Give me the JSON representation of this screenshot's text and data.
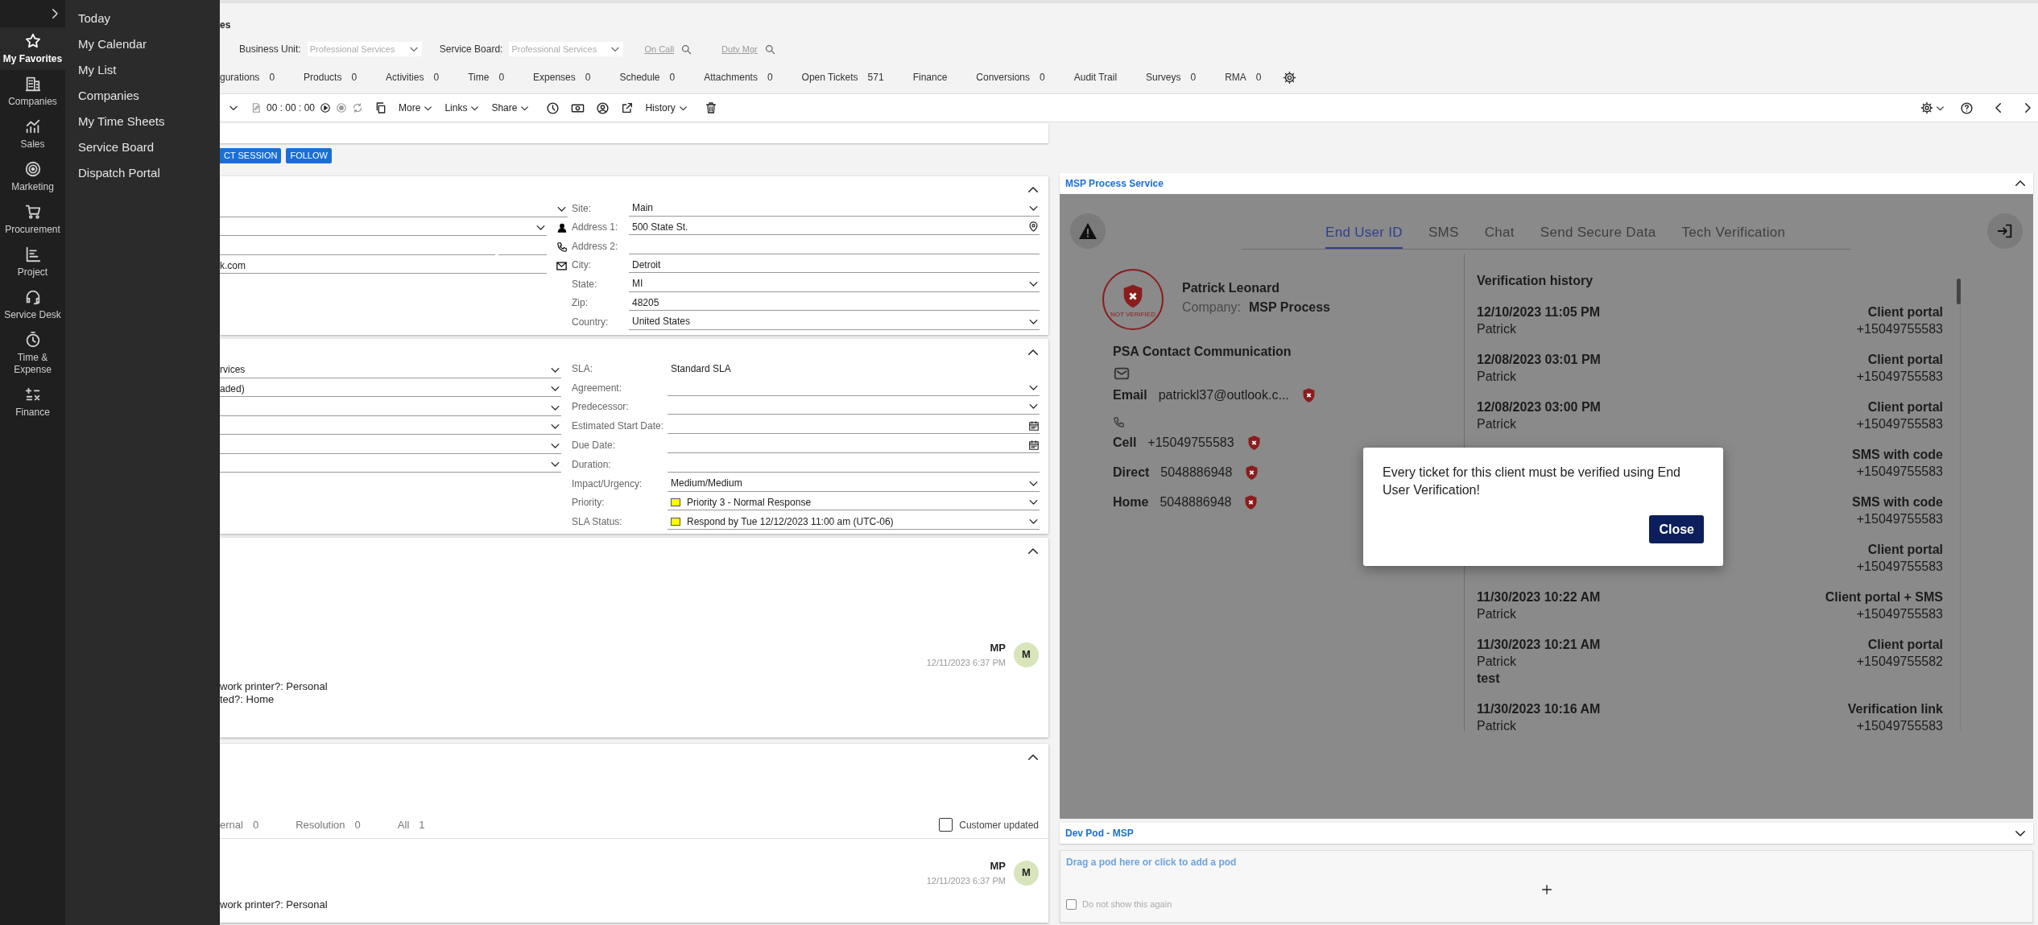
{
  "nav_rail": {
    "items": [
      {
        "label": "My Favorites",
        "selected": true
      },
      {
        "label": "Companies",
        "selected": false
      },
      {
        "label": "Sales",
        "selected": false
      },
      {
        "label": "Marketing",
        "selected": false
      },
      {
        "label": "Procurement",
        "selected": false
      },
      {
        "label": "Project",
        "selected": false
      },
      {
        "label": "Service Desk",
        "selected": false
      },
      {
        "label": "Time & Expense",
        "selected": false
      },
      {
        "label": "Finance",
        "selected": false
      }
    ]
  },
  "flyout": {
    "items": [
      "Today",
      "My Calendar",
      "My List",
      "Companies",
      "My Time Sheets",
      "Service Board",
      "Dispatch Portal"
    ]
  },
  "header": {
    "title": "es",
    "filters": [
      {
        "label": "Business Unit:",
        "placeholder": "Professional Services"
      },
      {
        "label": "Service Board:",
        "placeholder": "Professional Services"
      }
    ],
    "links": [
      "On Call",
      "Duty Mgr"
    ]
  },
  "tabs": [
    {
      "label": "gurations",
      "count": "0"
    },
    {
      "label": "Products",
      "count": "0"
    },
    {
      "label": "Activities",
      "count": "0"
    },
    {
      "label": "Time",
      "count": "0"
    },
    {
      "label": "Expenses",
      "count": "0"
    },
    {
      "label": "Schedule",
      "count": "0"
    },
    {
      "label": "Attachments",
      "count": "0"
    },
    {
      "label": "Open Tickets",
      "count": "571"
    },
    {
      "label": "Finance"
    },
    {
      "label": "Conversions",
      "count": "0"
    },
    {
      "label": "Audit Trail"
    },
    {
      "label": "Surveys",
      "count": "0"
    },
    {
      "label": "RMA",
      "count": "0"
    }
  ],
  "toolbar": {
    "timer": "00 : 00 : 00",
    "menus": [
      "More",
      "Links",
      "Share",
      "History"
    ]
  },
  "actions": [
    "CT SESSION",
    "FOLLOW"
  ],
  "contact_panel": {
    "left_fields": [
      {
        "kind": "select"
      },
      {
        "kind": "select"
      },
      {
        "kind": "split"
      },
      {
        "kind": "text",
        "value": "k.com"
      }
    ],
    "right_fields": [
      {
        "label": "Site:",
        "value": "Main",
        "kind": "select"
      },
      {
        "label": "Address 1:",
        "value": "500 State St.",
        "kind": "location"
      },
      {
        "label": "Address 2:",
        "kind": "text"
      },
      {
        "label": "City:",
        "value": "Detroit",
        "kind": "text"
      },
      {
        "label": "State:",
        "value": "MI",
        "kind": "select"
      },
      {
        "label": "Zip:",
        "value": "48205",
        "kind": "text"
      },
      {
        "label": "Country:",
        "value": "United States",
        "kind": "select"
      }
    ]
  },
  "service_panel": {
    "left_fields": [
      {
        "kind": "select",
        "value": "rvices"
      },
      {
        "kind": "select",
        "value": "aded)"
      },
      {
        "kind": "select"
      },
      {
        "kind": "select"
      },
      {
        "kind": "select"
      },
      {
        "kind": "select"
      }
    ],
    "right_fields": [
      {
        "label": "SLA:",
        "value": "Standard SLA",
        "kind": "static"
      },
      {
        "label": "Agreement:",
        "kind": "select"
      },
      {
        "label": "Predecessor:",
        "kind": "select"
      },
      {
        "label": "Estimated Start Date:",
        "kind": "date"
      },
      {
        "label": "Due Date:",
        "kind": "date"
      },
      {
        "label": "Duration:",
        "kind": "text"
      },
      {
        "label": "Impact/Urgency:",
        "value": "Medium/Medium",
        "kind": "select"
      },
      {
        "label": "Priority:",
        "value": "Priority 3 - Normal Response",
        "kind": "select",
        "color": "#ffff00"
      },
      {
        "label": "SLA Status:",
        "value": "Respond by Tue 12/12/2023 11:00 am (UTC-06)",
        "kind": "select",
        "color": "#ffff00"
      }
    ]
  },
  "description_panel": {
    "note": {
      "author": "MP",
      "time": "12/11/2023 6:37 PM",
      "avatar": "M",
      "lines": [
        "work printer?: Personal",
        "ted?: Home"
      ]
    }
  },
  "notes_panel": {
    "tabs": [
      {
        "label": "ernal",
        "count": "0"
      },
      {
        "label": "Resolution",
        "count": "0"
      },
      {
        "label": "All",
        "count": "1"
      }
    ],
    "checkbox": {
      "label": "Customer updated",
      "checked": false
    },
    "note": {
      "author": "MP",
      "time": "12/11/2023 6:37 PM",
      "avatar": "M",
      "lines": [
        "work printer?: Personal"
      ]
    }
  },
  "msp_pod": {
    "title": "MSP Process Service",
    "tabs": [
      {
        "label": "End User ID",
        "selected": true
      },
      {
        "label": "SMS",
        "selected": false
      },
      {
        "label": "Chat",
        "selected": false
      },
      {
        "label": "Send Secure Data",
        "selected": false
      },
      {
        "label": "Tech Verification",
        "selected": false
      }
    ],
    "contact": {
      "badge": "NOT VERIFIED",
      "name": "Patrick Leonard",
      "company_label": "Company:",
      "company": "MSP Process",
      "section_title": "PSA Contact Communication",
      "email": {
        "label": "Email",
        "value": "patrickl37@outlook.c...",
        "verified": false
      },
      "phones": [
        {
          "label": "Cell",
          "value": "+15049755583",
          "verified": false
        },
        {
          "label": "Direct",
          "value": "5048886948",
          "verified": false
        },
        {
          "label": "Home",
          "value": "5048886948",
          "verified": false
        }
      ]
    },
    "history": {
      "title": "Verification history",
      "entries": [
        {
          "date": "12/10/2023 11:05 PM",
          "name": "Patrick",
          "method": "Client portal",
          "phone": "+15049755583"
        },
        {
          "date": "12/08/2023 03:01 PM",
          "name": "Patrick",
          "method": "Client portal",
          "phone": "+15049755583"
        },
        {
          "date": "12/08/2023 03:00 PM",
          "name": "Patrick",
          "method": "Client portal",
          "phone": "+15049755583"
        },
        {
          "method": "SMS with code",
          "phone": "+15049755583"
        },
        {
          "method": "SMS with code",
          "phone": "+15049755583"
        },
        {
          "method": "Client portal",
          "phone": "+15049755583"
        },
        {
          "date": "11/30/2023 10:22 AM",
          "name": "Patrick",
          "method": "Client portal + SMS",
          "phone": "+15049755583"
        },
        {
          "date": "11/30/2023 10:21 AM",
          "name": "Patrick",
          "note": "test",
          "method": "Client portal",
          "phone": "+15049755582"
        },
        {
          "date": "11/30/2023 10:16 AM",
          "name": "Patrick",
          "method": "Verification link",
          "phone": "+15049755583"
        }
      ]
    },
    "dialog": {
      "message": "Every ticket for this client must be verified using End User Verification!",
      "button": "Close"
    }
  },
  "dev_pod": {
    "title": "Dev Pod - MSP",
    "hint": "Drag a pod here or click to add a pod",
    "checkbox": {
      "label": "Do not show this again",
      "checked": false
    }
  }
}
